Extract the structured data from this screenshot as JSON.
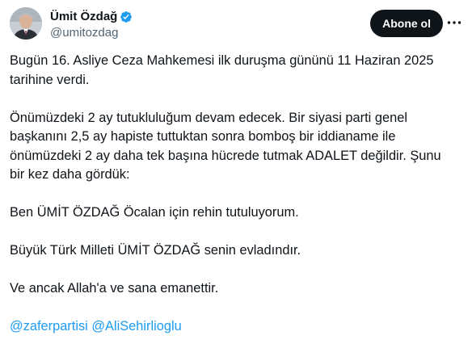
{
  "author": {
    "display_name": "Ümit Özdağ",
    "handle": "@umitozdag",
    "verified": true,
    "avatar": "profile-photo"
  },
  "actions": {
    "follow_label": "Abone ol",
    "more_icon": "more-dots-icon"
  },
  "tweet": {
    "paragraphs": [
      "Bugün 16. Asliye Ceza Mahkemesi ilk duruşma gününü 11 Haziran 2025 tarihine verdi.",
      "Önümüzdeki 2 ay tutukluluğum devam edecek. Bir siyasi parti genel başkanını 2,5 ay hapiste tuttuktan sonra bomboş bir iddianame ile önümüzdeki 2 ay daha tek başına hücrede tutmak ADALET değildir. Şunu bir kez daha gördük:",
      "Ben ÜMİT ÖZDAĞ Öcalan için rehin tutuluyorum.",
      "Büyük Türk Milleti ÜMİT ÖZDAĞ senin evladındır.",
      "Ve ancak Allah'a ve sana emanettir."
    ],
    "mentions": [
      "@zaferpartisi",
      "@AliSehirlioglu"
    ]
  },
  "colors": {
    "text": "#0f1419",
    "secondary": "#536471",
    "link": "#1d9bf0",
    "button_bg": "#0f1419",
    "verified_badge": "#1d9bf0"
  }
}
